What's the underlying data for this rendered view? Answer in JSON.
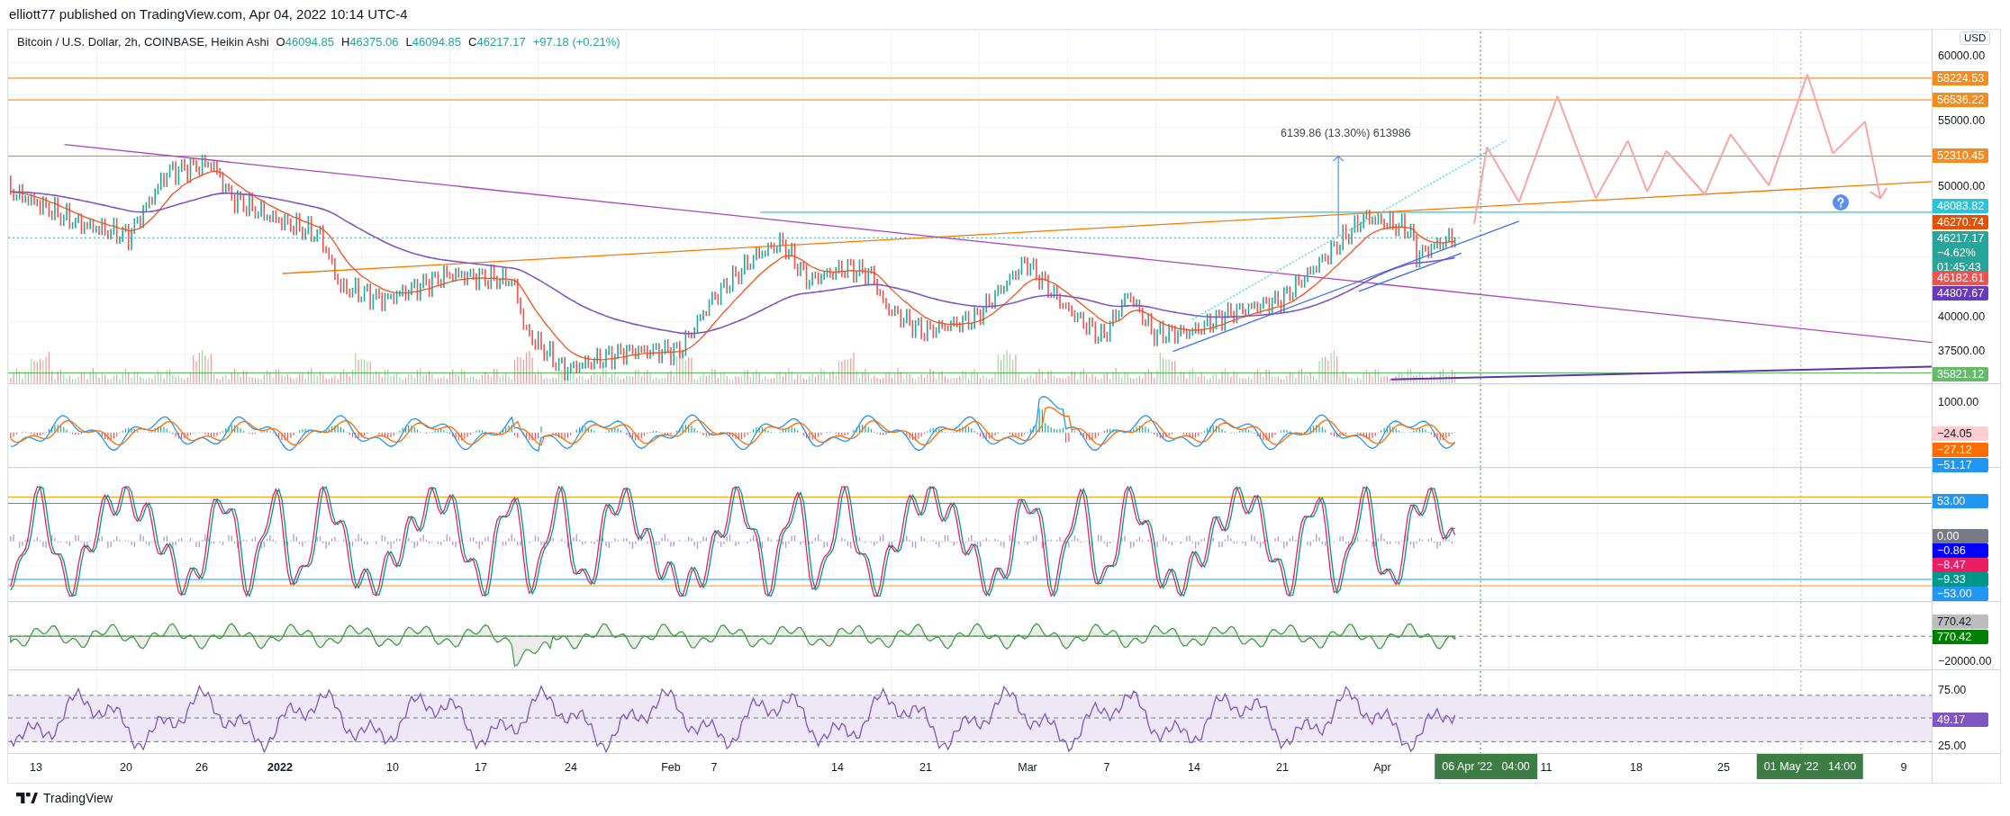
{
  "header": "elliott77 published on TradingView.com, Apr 04, 2022 10:14 UTC-4",
  "legend": {
    "title": "Bitcoin / U.S. Dollar, 2h, COINBASE, Heikin Ashi",
    "ohlc": [
      {
        "label": "O",
        "value": "46094.85"
      },
      {
        "label": "H",
        "value": "46375.06"
      },
      {
        "label": "L",
        "value": "46094.85"
      },
      {
        "label": "C",
        "value": "46217.17"
      }
    ],
    "change": "+97.18 (+0.21%)"
  },
  "currency_button": "USD",
  "measure_label": "6139.86 (13.30%) 613986",
  "panes": [
    {
      "kind": "price",
      "axis": [
        {
          "kind": "tick",
          "text": "60000.00"
        },
        {
          "kind": "badge",
          "text": "58224.53",
          "color": "#f68b1f"
        },
        {
          "kind": "badge",
          "text": "56536.22",
          "color": "#f68b1f"
        },
        {
          "kind": "tick",
          "text": "55000.00"
        },
        {
          "kind": "badge",
          "text": "52310.45",
          "color": "#f68b1f"
        },
        {
          "kind": "tick",
          "text": "50000.00"
        },
        {
          "kind": "badge",
          "text": "48083.82",
          "color": "#26c6da"
        },
        {
          "kind": "badge",
          "text": "46270.74",
          "color": "#e65100"
        },
        {
          "kind": "badge",
          "text": "46217.17",
          "color": "#26a69a",
          "subtexts": [
            "−4.62%",
            "01:45:43"
          ]
        },
        {
          "kind": "badge",
          "text": "46182.61",
          "color": "#ef5350"
        },
        {
          "kind": "badge",
          "text": "44807.67",
          "color": "#673ab7"
        },
        {
          "kind": "tick",
          "text": "40000.00"
        },
        {
          "kind": "tick",
          "text": "37500.00"
        },
        {
          "kind": "badge",
          "text": "35821.12",
          "color": "#66bb6a"
        }
      ]
    },
    {
      "kind": "macd",
      "axis": [
        {
          "kind": "tick",
          "text": "1000.00"
        },
        {
          "kind": "badge",
          "text": "−24.05",
          "color": "#ffcdd2"
        },
        {
          "kind": "badge",
          "text": "−27.12",
          "color": "#ff6d00"
        },
        {
          "kind": "badge",
          "text": "−51.17",
          "color": "#2196f3"
        }
      ]
    },
    {
      "kind": "stochastic",
      "axis": [
        {
          "kind": "badge",
          "text": "53.00",
          "color": "#2196f3"
        },
        {
          "kind": "badge",
          "text": "0.00",
          "color": "#787b86"
        },
        {
          "kind": "badge",
          "text": "−0.86",
          "color": "#0000ff"
        },
        {
          "kind": "badge",
          "text": "−8.47",
          "color": "#e91e63"
        },
        {
          "kind": "badge",
          "text": "−9.33",
          "color": "#009688"
        },
        {
          "kind": "badge",
          "text": "−53.00",
          "color": "#2196f3"
        }
      ]
    },
    {
      "kind": "oscillator",
      "axis": [
        {
          "kind": "badge",
          "text": "770.42",
          "color": "#bdbdbd"
        },
        {
          "kind": "badge",
          "text": "770.42",
          "color": "#008000"
        },
        {
          "kind": "tick",
          "text": "−20000.00"
        }
      ]
    },
    {
      "kind": "rsi",
      "axis": [
        {
          "kind": "tick",
          "text": "75.00"
        },
        {
          "kind": "badge",
          "text": "49.17",
          "color": "#7e57c2"
        },
        {
          "kind": "tick",
          "text": "25.00"
        }
      ]
    }
  ],
  "time_axis": [
    {
      "kind": "tick",
      "text": "13"
    },
    {
      "kind": "tick",
      "text": "20"
    },
    {
      "kind": "tick",
      "text": "26"
    },
    {
      "kind": "year",
      "text": "2022"
    },
    {
      "kind": "tick",
      "text": "10"
    },
    {
      "kind": "tick",
      "text": "17"
    },
    {
      "kind": "tick",
      "text": "24"
    },
    {
      "kind": "tick",
      "text": "Feb"
    },
    {
      "kind": "tick",
      "text": "7"
    },
    {
      "kind": "tick",
      "text": "14"
    },
    {
      "kind": "tick",
      "text": "21"
    },
    {
      "kind": "tick",
      "text": "Mar"
    },
    {
      "kind": "tick",
      "text": "7"
    },
    {
      "kind": "tick",
      "text": "14"
    },
    {
      "kind": "tick",
      "text": "21"
    },
    {
      "kind": "tick",
      "text": "Apr"
    },
    {
      "kind": "badge",
      "text": "06 Apr '22   04:00"
    },
    {
      "kind": "tick",
      "text": "11"
    },
    {
      "kind": "tick",
      "text": "18"
    },
    {
      "kind": "tick",
      "text": "25"
    },
    {
      "kind": "badge",
      "text": "01 May '22   14:00"
    },
    {
      "kind": "tick",
      "text": "9"
    }
  ],
  "footer": "TradingView"
}
